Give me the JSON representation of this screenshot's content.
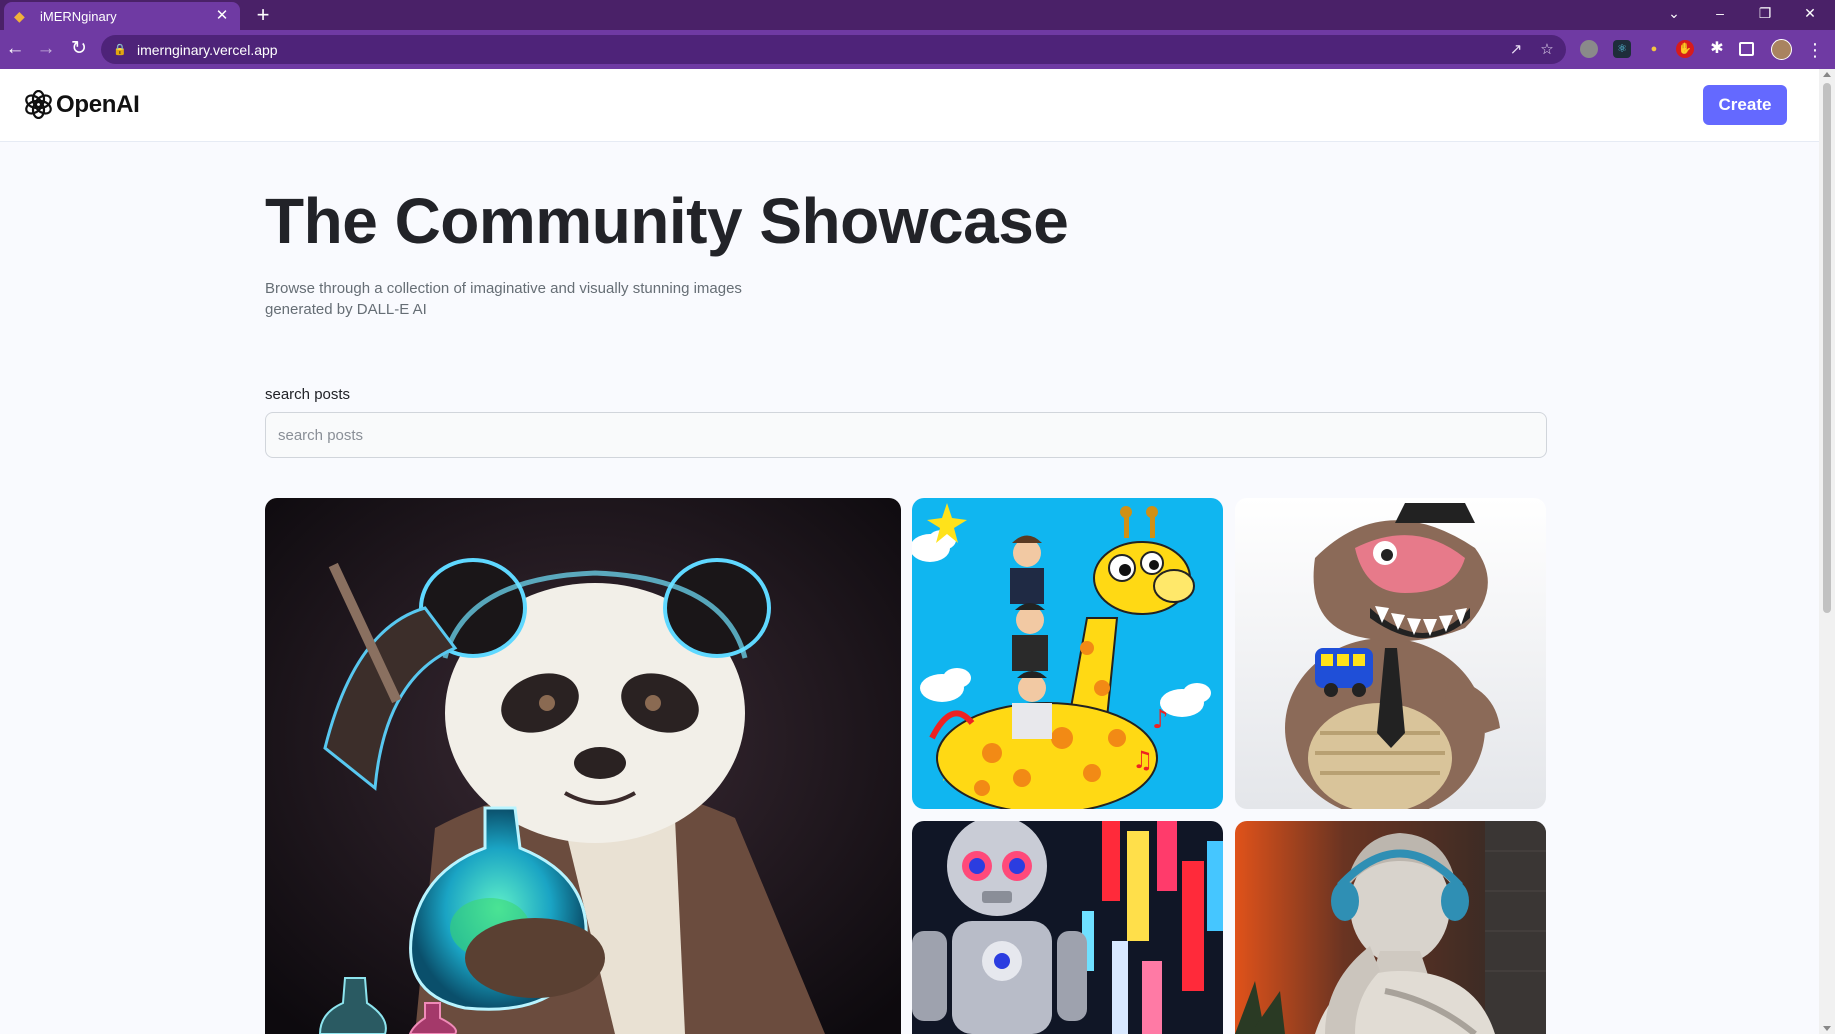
{
  "browser": {
    "tab": {
      "title": "iMERNginary",
      "favicon": "gem-icon"
    },
    "url": "imernginary.vercel.app",
    "accent": "#6f3aa3"
  },
  "site": {
    "brand": "OpenAI",
    "create_label": "Create",
    "accent": "#6469ff"
  },
  "hero": {
    "title": "The Community Showcase",
    "subtitle": "Browse through a collection of imaginative and visually stunning images generated by DALL-E AI"
  },
  "search": {
    "label": "search posts",
    "placeholder": "search posts",
    "value": ""
  },
  "gallery": {
    "items": [
      {
        "subject": "panda scientist holding flask"
      },
      {
        "subject": "cartoon giraffe with people on its back"
      },
      {
        "subject": "dinosaur in a tie with a toy bus"
      },
      {
        "subject": "robot on neon street"
      },
      {
        "subject": "statue wearing headphones"
      }
    ]
  }
}
